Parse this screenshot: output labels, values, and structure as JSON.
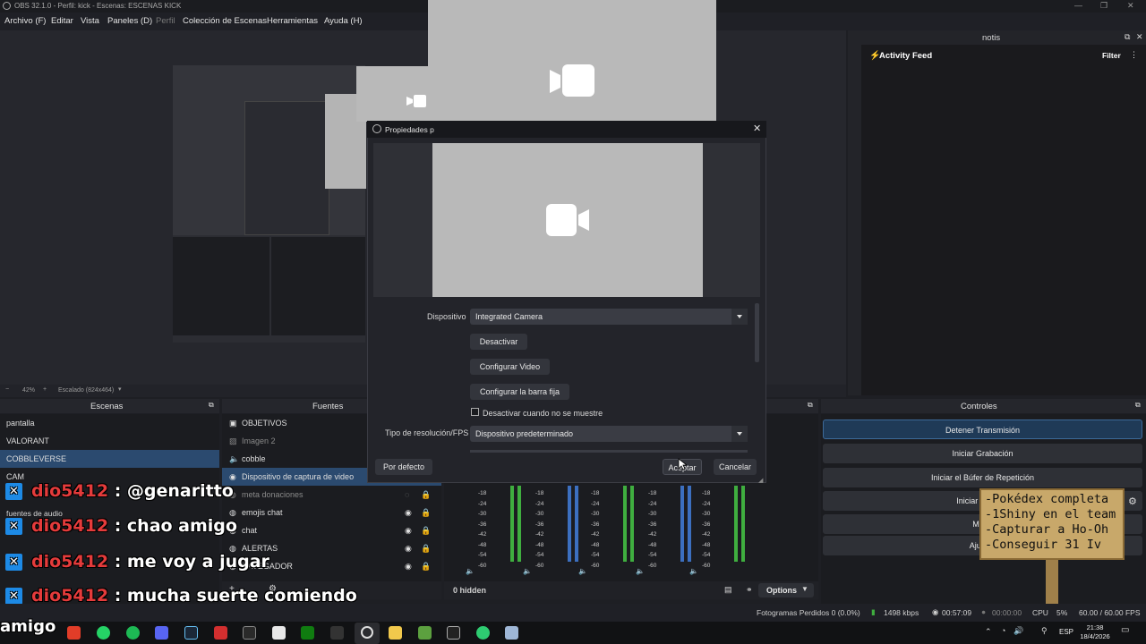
{
  "window": {
    "title": "OBS 32.1.0 - Perfil: kick - Escenas: ESCENAS KICK"
  },
  "menu": [
    "Archivo (F)",
    "Editar",
    "Vista",
    "Paneles (D)",
    "Perfil",
    "Colección de Escenas",
    "Herramientas",
    "Ayuda (H)"
  ],
  "preview": {
    "zoom": "42%",
    "scale_label": "Escalado (824x464)"
  },
  "notis": {
    "title": "notis",
    "feed_title": "Activity Feed",
    "filter_label": "Filter"
  },
  "scenes": {
    "title": "Escenas",
    "items": [
      "pantalla",
      "VALORANT",
      "COBBLEVERSE",
      "CAM"
    ],
    "audio_label": "fuentes de audio"
  },
  "sources": {
    "title": "Fuentes",
    "items": [
      "OBJETIVOS",
      "Imagen 2",
      "cobble",
      "Dispositivo de captura de video",
      "meta donaciones",
      "emojis chat",
      "chat",
      "ALERTAS",
      "NAVEGADOR"
    ]
  },
  "mixer": {
    "hidden_label": "0 hidden",
    "options_label": "Options",
    "scale": [
      "-18",
      "-24",
      "-30",
      "-36",
      "-42",
      "-48",
      "-54",
      "-60"
    ]
  },
  "controls": {
    "title": "Controles",
    "buttons": [
      "Detener Transmisión",
      "Iniciar Grabación",
      "Iniciar el Búfer de Repetición",
      "Iniciar Cámara",
      "Modo",
      "Ajustes"
    ]
  },
  "dialog": {
    "title": "Propiedades p",
    "device_label": "Dispositivo",
    "device_value": "Integrated Camera",
    "btn_deactivate": "Desactivar",
    "btn_config_video": "Configurar Video",
    "btn_config_bar": "Configurar la barra fija",
    "checkbox_label": "Desactivar cuando no se muestre",
    "res_label": "Tipo de resolución/FPS",
    "res_value": "Dispositivo predeterminado",
    "btn_defaults": "Por defecto",
    "btn_accept": "Aceptar",
    "btn_cancel": "Cancelar"
  },
  "chat_overlay": {
    "lines": [
      {
        "user": "dio5412",
        "msg": ": @genaritto"
      },
      {
        "user": "dio5412",
        "msg": ": chao amigo"
      },
      {
        "user": "dio5412",
        "msg": ": me voy a jugar"
      },
      {
        "user": "dio5412",
        "msg": ": mucha suerte comiendo"
      }
    ],
    "trailing": "amigo"
  },
  "sign": {
    "lines": [
      "-Pokédex completa",
      "-1Shiny en el team",
      "-Capturar a Ho-Oh",
      "-Conseguir 31 Iv"
    ]
  },
  "status": {
    "dropped": "Fotogramas Perdidos 0 (0.0%)",
    "kbps": "1498 kbps",
    "stream_time": "00:57:09",
    "rec_time": "00:00:00",
    "cpu": "CPU",
    "cpu_pct": "5%",
    "fps": "60.00 / 60.00 FPS"
  },
  "taskbar": {
    "lang": "ESP",
    "time": "21:38",
    "date": "18/4/2026"
  },
  "colors": {
    "accent": "#2b4a6f",
    "stream_active": "#1f3a57",
    "chat_user": "#e53b3b",
    "kick_blue": "#1d8ae6",
    "meter_green": "#3fae3f",
    "meter_blue": "#3c6fbf"
  }
}
